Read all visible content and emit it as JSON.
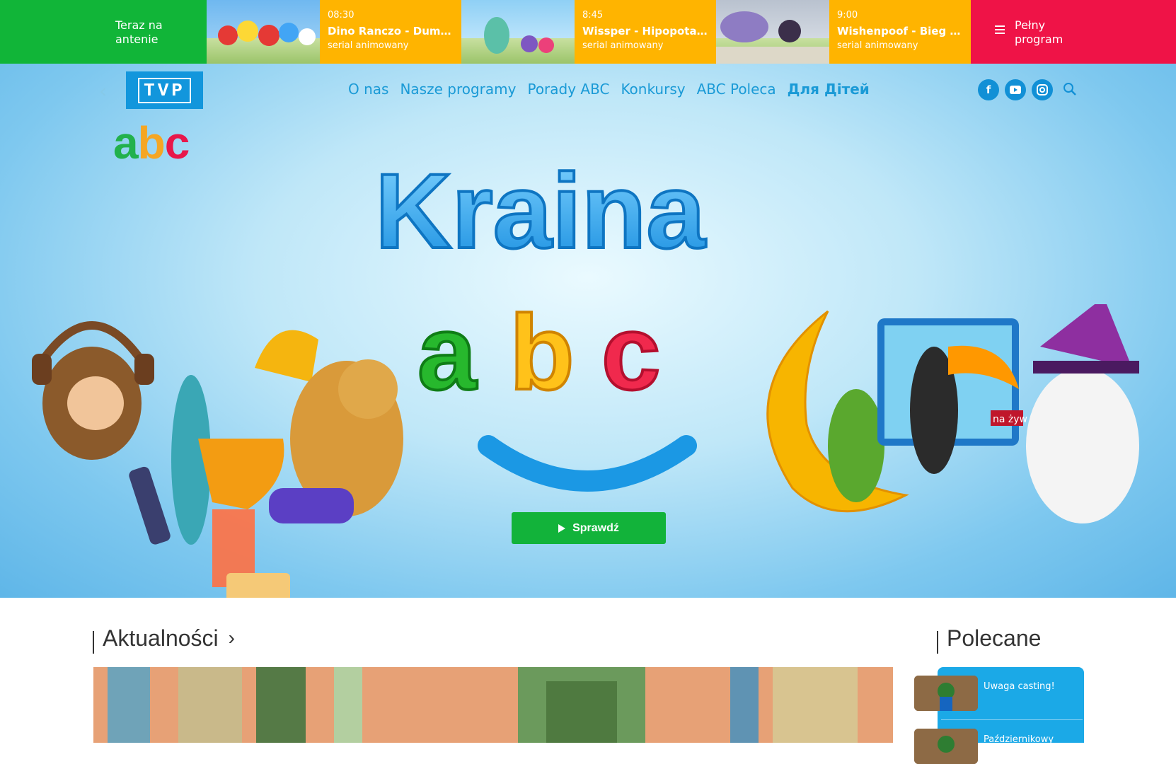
{
  "schedule": {
    "now_label": "Teraz na antenie",
    "items": [
      {
        "time": "08:30",
        "title": "Dino Ranczo - Duma ...",
        "genre": "serial animowany"
      },
      {
        "time": "8:45",
        "title": "Wissper - Hipopotam...",
        "genre": "serial animowany"
      },
      {
        "time": "9:00",
        "title": "Wishenpoof - Bieg z ...",
        "genre": "serial animowany"
      }
    ],
    "full_label": "Pełny program"
  },
  "header": {
    "tvp_logo": "TVP",
    "abc_logo": [
      "a",
      "b",
      "c"
    ],
    "nav": [
      "O nas",
      "Nasze programy",
      "Porady ABC",
      "Konkursy",
      "ABC Poleca",
      "Для Дітей"
    ],
    "social": [
      "facebook-icon",
      "youtube-icon",
      "instagram-icon",
      "search-icon"
    ]
  },
  "hero": {
    "title_line1": "Kraina",
    "title_line2": [
      "a",
      "b",
      "c"
    ],
    "tv_badge": "na żyw",
    "cta_label": "Sprawdź"
  },
  "sections": {
    "news_title": "Aktualności",
    "recommended_title": "Polecane",
    "recommended": [
      "Uwaga casting!",
      "Październikowy"
    ]
  },
  "colors": {
    "green": "#11b538",
    "yellow": "#ffb400",
    "red": "#ef1347",
    "blue": "#1a9ad6"
  }
}
